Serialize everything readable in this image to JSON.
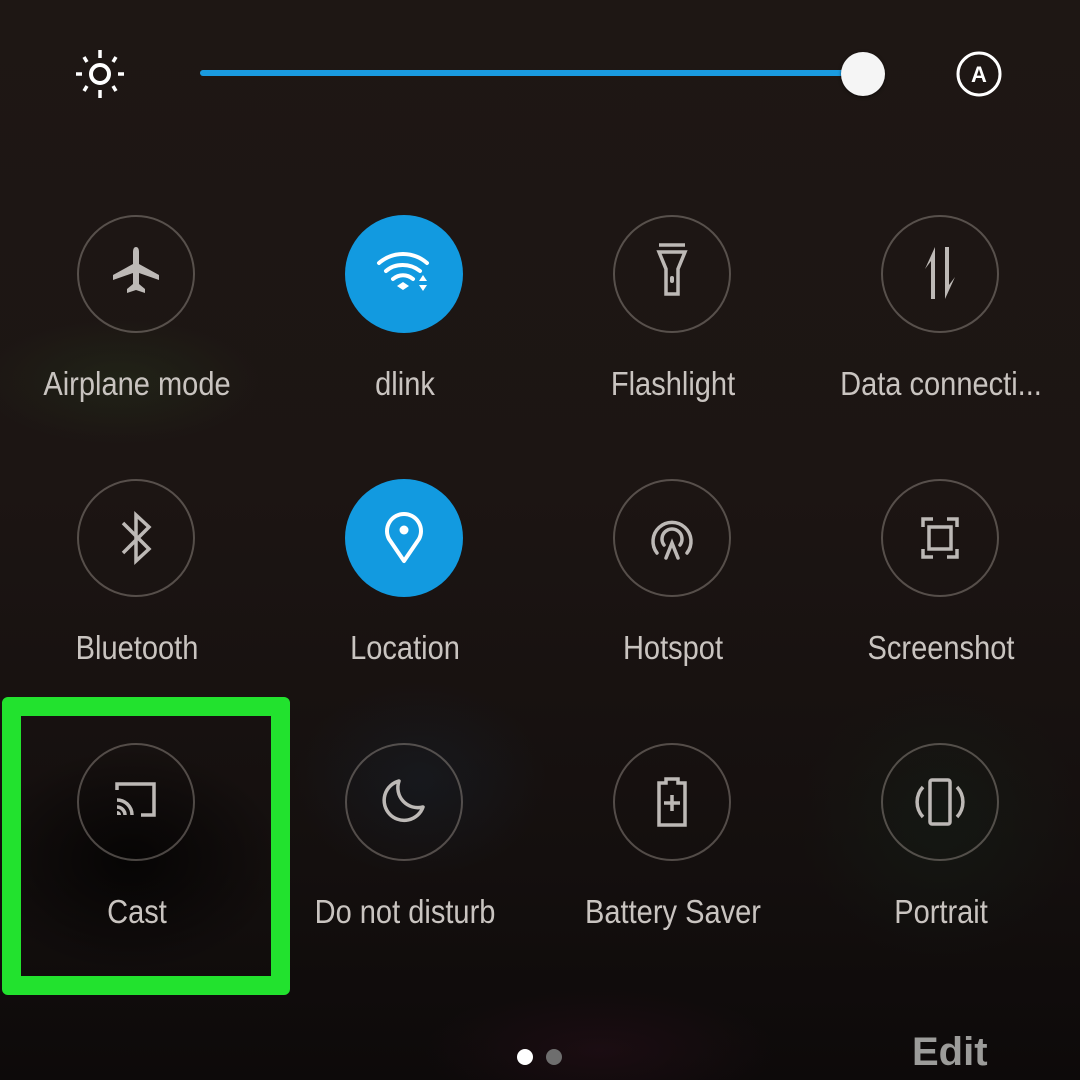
{
  "brightness": {
    "level_percent": 100,
    "auto_label": "A",
    "accent_color": "#1a9be0"
  },
  "tiles": [
    {
      "label": "Airplane mode",
      "icon": "airplane-icon",
      "active": false
    },
    {
      "label": "dlink",
      "icon": "wifi-icon",
      "active": true
    },
    {
      "label": "Flashlight",
      "icon": "flashlight-icon",
      "active": false
    },
    {
      "label": "Data connecti...",
      "icon": "data-connection-icon",
      "active": false
    },
    {
      "label": "Bluetooth",
      "icon": "bluetooth-icon",
      "active": false
    },
    {
      "label": "Location",
      "icon": "location-icon",
      "active": true
    },
    {
      "label": "Hotspot",
      "icon": "hotspot-icon",
      "active": false
    },
    {
      "label": "Screenshot",
      "icon": "screenshot-icon",
      "active": false
    },
    {
      "label": "Cast",
      "icon": "cast-icon",
      "active": false
    },
    {
      "label": "Do not disturb",
      "icon": "moon-icon",
      "active": false
    },
    {
      "label": "Battery Saver",
      "icon": "battery-saver-icon",
      "active": false
    },
    {
      "label": "Portrait",
      "icon": "rotation-icon",
      "active": false
    }
  ],
  "highlighted_tile": "Cast",
  "highlight_color": "#22e22e",
  "pager": {
    "pages": 2,
    "current": 1
  },
  "edit_label": "Edit"
}
